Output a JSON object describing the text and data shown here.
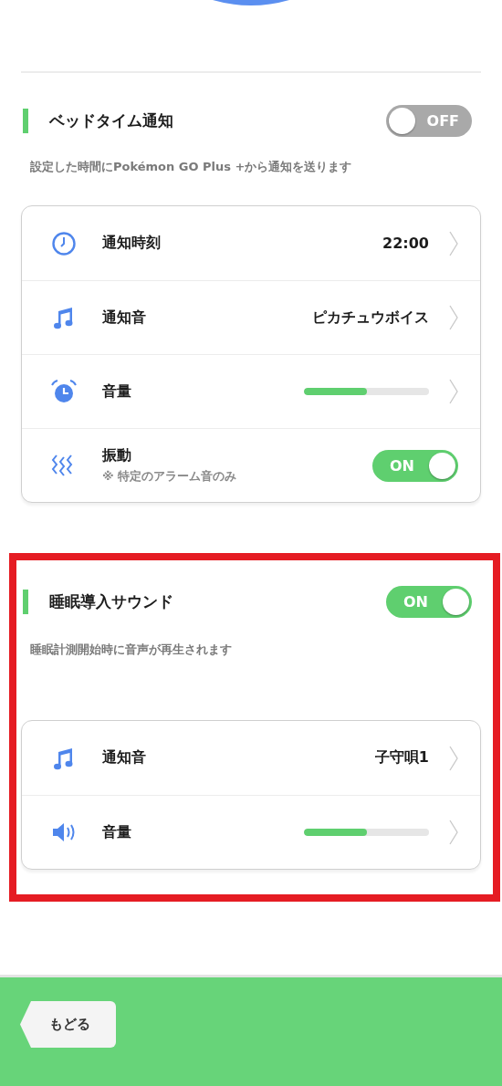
{
  "sections": [
    {
      "title": "ベッドタイム通知",
      "on": false,
      "toggle_label": "OFF",
      "description": "設定した時間にPokémon GO Plus +から通知を送ります",
      "highlighted": false,
      "rows": [
        {
          "kind": "value",
          "label": "通知時刻",
          "value": "22:00"
        },
        {
          "kind": "value",
          "label": "通知音",
          "value": "ピカチュウボイス"
        },
        {
          "kind": "slider",
          "label": "音量",
          "level": 0.5
        },
        {
          "kind": "toggle",
          "label": "振動",
          "note": "※ 特定のアラーム音のみ",
          "on": true,
          "toggle_label": "ON"
        }
      ]
    },
    {
      "title": "睡眠導入サウンド",
      "on": true,
      "toggle_label": "ON",
      "description": "睡眠計測開始時に音声が再生されます",
      "highlighted": true,
      "rows": [
        {
          "kind": "value",
          "label": "通知音",
          "value": "子守唄1"
        },
        {
          "kind": "slider",
          "label": "音量",
          "level": 0.5
        }
      ]
    }
  ],
  "back_button": "もどる"
}
